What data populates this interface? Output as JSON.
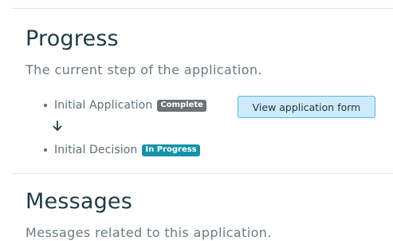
{
  "progress": {
    "title": "Progress",
    "description": "The current step of the application.",
    "steps": [
      {
        "label": "Initial Application",
        "status": "Complete",
        "status_color": "#6c7275"
      },
      {
        "label": "Initial Decision",
        "status": "In Progress",
        "status_color": "#1592a8"
      }
    ],
    "view_button_label": "View application form",
    "connector_icon": "arrow-down-icon"
  },
  "messages": {
    "title": "Messages",
    "description": "Messages related to this application."
  },
  "colors": {
    "heading": "#1f3b45",
    "muted_text": "#6b7b82",
    "button_bg": "#cdebfa",
    "button_border": "#56b6e3"
  }
}
